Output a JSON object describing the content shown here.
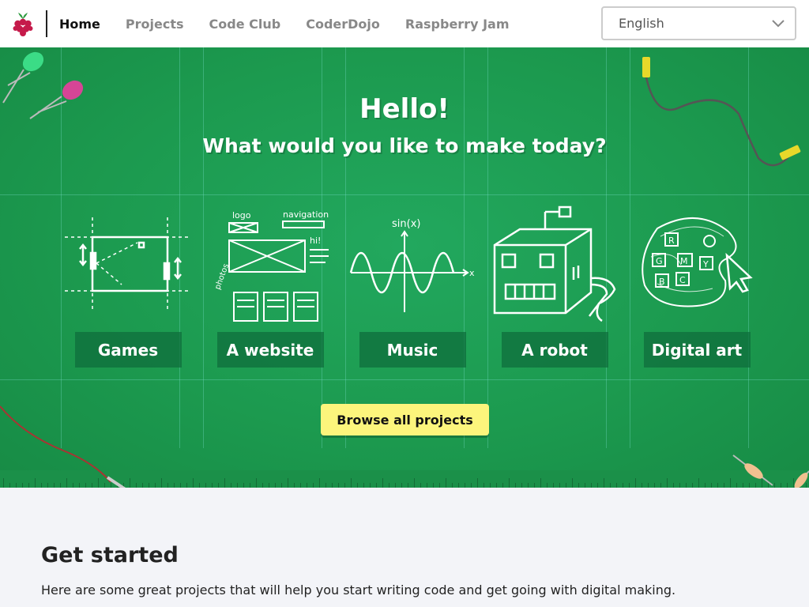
{
  "header": {
    "logo": "raspberry-pi-logo",
    "nav": [
      {
        "label": "Home",
        "active": true
      },
      {
        "label": "Projects",
        "active": false
      },
      {
        "label": "Code Club",
        "active": false
      },
      {
        "label": "CoderDojo",
        "active": false
      },
      {
        "label": "Raspberry Jam",
        "active": false
      }
    ],
    "language": {
      "selected": "English",
      "icon": "chevron-down-icon"
    }
  },
  "hero": {
    "title": "Hello!",
    "subtitle": "What would you like to make today?",
    "categories": [
      {
        "label": "Games",
        "icon": "games-sketch-icon"
      },
      {
        "label": "A website",
        "icon": "website-sketch-icon"
      },
      {
        "label": "Music",
        "icon": "music-sketch-icon"
      },
      {
        "label": "A robot",
        "icon": "robot-sketch-icon"
      },
      {
        "label": "Digital art",
        "icon": "digital-art-sketch-icon"
      }
    ],
    "sketch_text": {
      "website_logo": "logo",
      "website_nav": "navigation",
      "website_hi": "hi!",
      "website_photos": "photos",
      "music_sin": "sin(x)",
      "music_x": "x",
      "art_letters": [
        "R",
        "G",
        "M",
        "Y",
        "B",
        "C"
      ]
    },
    "browse_button": "Browse all projects",
    "colors": {
      "background": "#1c9a4f",
      "button": "#fcf57c"
    }
  },
  "get_started": {
    "title": "Get started",
    "text": "Here are some great projects that will help you start writing code and get going with digital making."
  }
}
